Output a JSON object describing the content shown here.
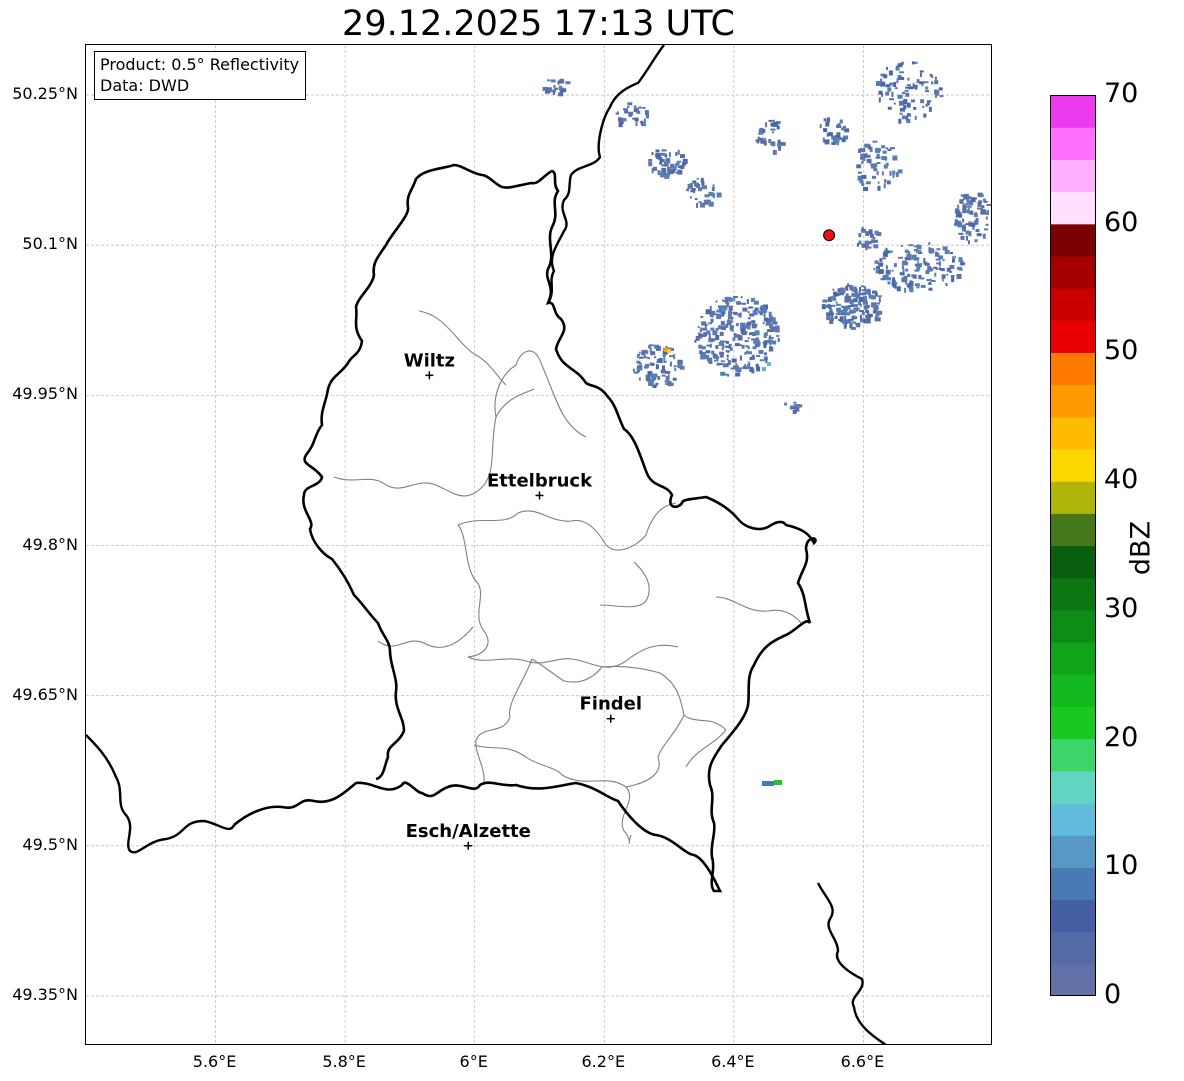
{
  "title": "29.12.2025 17:13 UTC",
  "info": {
    "product": "Product: 0.5° Reflectivity",
    "data": "Data: DWD"
  },
  "axes": {
    "y_ticks": [
      "50.25°N",
      "50.1°N",
      "49.95°N",
      "49.8°N",
      "49.65°N",
      "49.5°N",
      "49.35°N"
    ],
    "x_ticks": [
      "5.6°E",
      "5.8°E",
      "6°E",
      "6.2°E",
      "6.4°E",
      "6.6°E"
    ],
    "lon_range": [
      5.4,
      6.8
    ],
    "lat_range": [
      49.3,
      50.3
    ]
  },
  "cities": [
    {
      "name": "Wiltz",
      "lon": 5.93,
      "lat": 49.97
    },
    {
      "name": "Ettelbruck",
      "lon": 6.1,
      "lat": 49.85
    },
    {
      "name": "Findel",
      "lon": 6.21,
      "lat": 49.627
    },
    {
      "name": "Esch/Alzette",
      "lon": 5.99,
      "lat": 49.5
    }
  ],
  "radar_site": {
    "lon": 6.547,
    "lat": 50.11,
    "color": "#e81010"
  },
  "colorbar": {
    "label": "dBZ",
    "ticks": [
      "0",
      "10",
      "20",
      "30",
      "40",
      "50",
      "60",
      "70"
    ],
    "colors": [
      "#6272a8",
      "#536aa5",
      "#445fa3",
      "#4a7ab5",
      "#5898c5",
      "#62bcdb",
      "#5fd5c2",
      "#3dd56a",
      "#18c921",
      "#12b81d",
      "#10a41a",
      "#0f8c16",
      "#0c7612",
      "#085d0f",
      "#45771a",
      "#b0b308",
      "#ffd700",
      "#ffbb00",
      "#ff9a00",
      "#ff7b00",
      "#e80000",
      "#c80000",
      "#a50000",
      "#7b0000",
      "#ffe0ff",
      "#ffb0ff",
      "#ff70ff",
      "#ee3aee"
    ]
  }
}
